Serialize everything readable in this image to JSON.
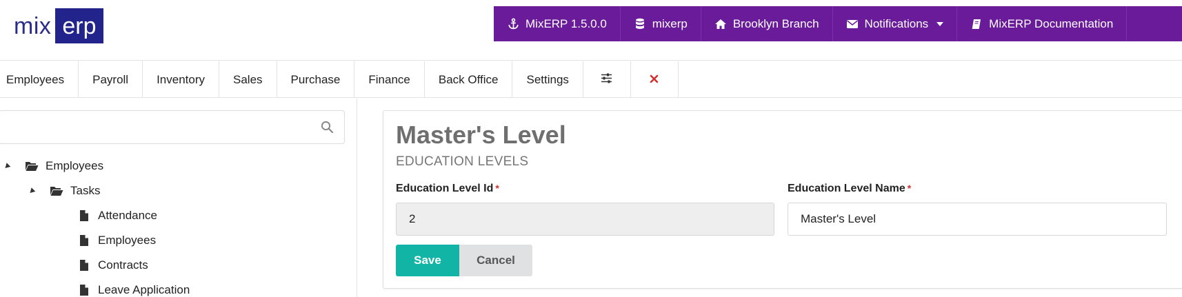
{
  "logo": {
    "left_text": "mix",
    "right_text": "erp"
  },
  "topbar": {
    "version": "MixERP 1.5.0.0",
    "database": "mixerp",
    "branch": "Brooklyn Branch",
    "notifications": "Notifications",
    "documentation": "MixERP Documentation",
    "colors": {
      "background": "#6a1b9a",
      "text": "#ffffff"
    },
    "icons": {
      "version": "anchor-icon",
      "database": "database-icon",
      "branch": "home-icon",
      "notifications": "envelope-icon",
      "documentation": "book-icon"
    }
  },
  "menu": {
    "items": [
      "Employees",
      "Payroll",
      "Inventory",
      "Sales",
      "Purchase",
      "Finance",
      "Back Office",
      "Settings"
    ],
    "icons": [
      "sliders-icon",
      "close-icon"
    ]
  },
  "sidebar": {
    "search": {
      "value": "",
      "placeholder": ""
    },
    "tree": {
      "root": "Employees",
      "child": "Tasks",
      "leaves": [
        "Attendance",
        "Employees",
        "Contracts",
        "Leave Application"
      ]
    }
  },
  "form": {
    "title": "Master's Level",
    "subtitle": "EDUCATION LEVELS",
    "fields": [
      {
        "label": "Education Level Id",
        "required_mark": "*",
        "value": "2",
        "readonly": true
      },
      {
        "label": "Education Level Name",
        "required_mark": "*",
        "value": "Master's Level",
        "readonly": false
      }
    ],
    "buttons": {
      "save": "Save",
      "cancel": "Cancel"
    },
    "colors": {
      "save": "#12b5a5",
      "cancel": "#e0e1e2",
      "required": "#d32f2f"
    }
  }
}
